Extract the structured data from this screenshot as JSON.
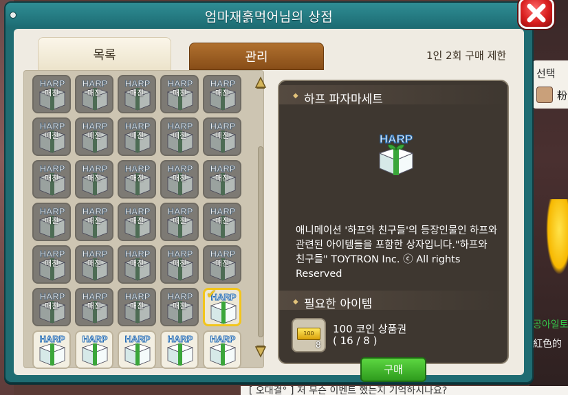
{
  "background": {
    "side_title": "선택",
    "side_text": "粉",
    "green_text": "공아일토",
    "red_text": "紅色的",
    "chat_line": "[ 오대결° ] 저 무슨 이벤트 했는지 기억하시나요?"
  },
  "window": {
    "title": "엄마재흙먹어님의 상점",
    "close_icon": "close-x-icon"
  },
  "tabs": [
    {
      "label": "목록",
      "active": true
    },
    {
      "label": "관리",
      "active": false
    }
  ],
  "purchase_limit": "1인 2회 구매 제한",
  "grid": {
    "rows": [
      {
        "slots": [
          {
            "type": "soldout",
            "label": "매진"
          },
          {
            "type": "soldout",
            "label": "매진"
          },
          {
            "type": "soldout",
            "label": "매진"
          },
          {
            "type": "soldout",
            "label": "매진"
          },
          {
            "type": "soldout",
            "label": "매진"
          }
        ]
      },
      {
        "slots": [
          {
            "type": "soldout",
            "label": "매진"
          },
          {
            "type": "soldout",
            "label": "매진"
          },
          {
            "type": "soldout",
            "label": "매진"
          },
          {
            "type": "soldout",
            "label": "매진"
          },
          {
            "type": "soldout",
            "label": "매진"
          }
        ]
      },
      {
        "slots": [
          {
            "type": "soldout",
            "label": "매진"
          },
          {
            "type": "soldout",
            "label": "매진"
          },
          {
            "type": "soldout",
            "label": "매진"
          },
          {
            "type": "soldout",
            "label": "매진"
          },
          {
            "type": "soldout",
            "label": "매진"
          }
        ]
      },
      {
        "slots": [
          {
            "type": "soldout",
            "label": "매진"
          },
          {
            "type": "soldout",
            "label": "매진"
          },
          {
            "type": "soldout",
            "label": "매진"
          },
          {
            "type": "soldout",
            "label": "매진"
          },
          {
            "type": "soldout",
            "label": "매진"
          }
        ]
      },
      {
        "slots": [
          {
            "type": "soldout",
            "label": "매진"
          },
          {
            "type": "soldout",
            "label": "매진"
          },
          {
            "type": "soldout",
            "label": "매진"
          },
          {
            "type": "soldout",
            "label": "매진"
          },
          {
            "type": "soldout",
            "label": "매진"
          }
        ]
      },
      {
        "slots": [
          {
            "type": "soldout",
            "label": "매진"
          },
          {
            "type": "soldout",
            "label": "매진"
          },
          {
            "type": "soldout",
            "label": "매진"
          },
          {
            "type": "soldout",
            "label": "매진"
          },
          {
            "type": "selected",
            "label": ""
          }
        ]
      },
      {
        "slots": [
          {
            "type": "available",
            "label": ""
          },
          {
            "type": "available",
            "label": ""
          },
          {
            "type": "available",
            "label": ""
          },
          {
            "type": "available",
            "label": ""
          },
          {
            "type": "available",
            "label": ""
          }
        ]
      }
    ],
    "item_logo_text": "HARP"
  },
  "detail": {
    "name": "하프 파자마세트",
    "description": "애니메이션 '하프와 친구들'의 등장인물인 하프와 관련된 아이템들을 포함한 상자입니다.\"하프와 친구들\" TOYTRON Inc. ⓒ All rights Reserved",
    "required_title": "필요한 아이템",
    "required_item": {
      "name": "100 코인 상품권",
      "quantity": "( 16 / 8 )",
      "count_badge": "8",
      "ticket_text": "100"
    },
    "buy_label": "구매"
  },
  "colors": {
    "window_frame": "#1f6c72",
    "detail_bg": "#3e3730",
    "buy_green": "#2e9b1d",
    "select_gold": "#f2c51c"
  }
}
